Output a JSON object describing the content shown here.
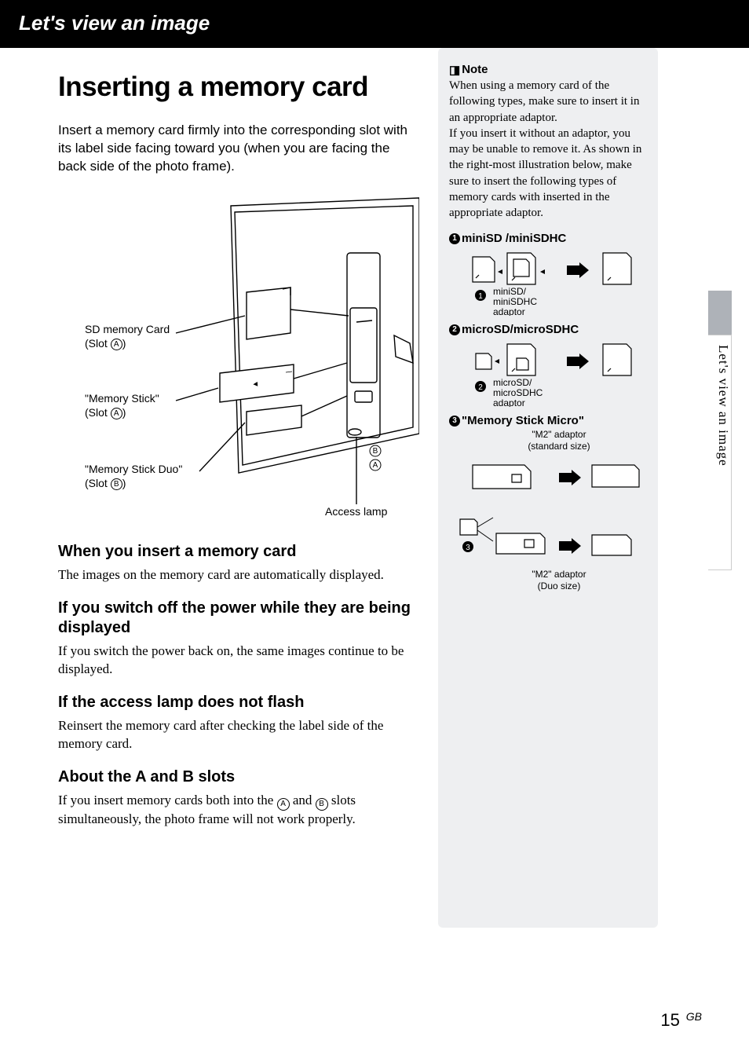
{
  "header": {
    "section_title": "Let's view an image"
  },
  "page": {
    "title": "Inserting a memory card",
    "intro": "Insert a memory card firmly into the corresponding slot with its label side facing toward you (when you are facing the back side of the photo frame)."
  },
  "figure": {
    "label_sd": "SD memory Card",
    "label_sd_slot": "(Slot A)",
    "label_ms": "\"Memory Stick\"",
    "label_ms_slot": "(Slot A)",
    "label_msduo": "\"Memory Stick Duo\"",
    "label_msduo_slot": "(Slot B)",
    "access_lamp": "Access lamp",
    "slot_a": "A",
    "slot_b": "B"
  },
  "sections": {
    "s1_h": "When you insert a memory card",
    "s1_b": "The images on the memory card are automatically displayed.",
    "s2_h": "If you switch off the power while they are being displayed",
    "s2_b": "If you switch the power back on, the same images continue to be displayed.",
    "s3_h": "If the access lamp does not flash",
    "s3_b": "Reinsert the memory card after checking the label side of the memory card.",
    "s4_h": "About the A and B slots",
    "s4_b_pre": "If you insert memory cards both into the ",
    "s4_b_mid": " and ",
    "s4_b_post": " slots simultaneously, the photo frame will not work properly."
  },
  "sidebar": {
    "note_label": "Note",
    "note_body": "When using a memory card of the following types, make sure to insert it in an appropriate adaptor.\nIf you insert it without an adaptor, you may be unable to remove it. As shown in the right-most illustration below, make sure to insert the following types of memory cards with inserted in the appropriate adaptor.",
    "item1_h": "miniSD /miniSDHC",
    "item1_cap": "miniSD/\nminiSDHC\nadaptor",
    "item2_h": "microSD/microSDHC",
    "item2_cap": "microSD/\nmicroSDHC\nadaptor",
    "item3_h": "\"Memory Stick Micro\"",
    "item3_cap_top": "\"M2\" adaptor\n(standard size)",
    "item3_cap_bottom": "\"M2\" adaptor\n(Duo size)"
  },
  "right_tab": "Let's view an image",
  "footer": {
    "page_number": "15",
    "region": "GB"
  }
}
